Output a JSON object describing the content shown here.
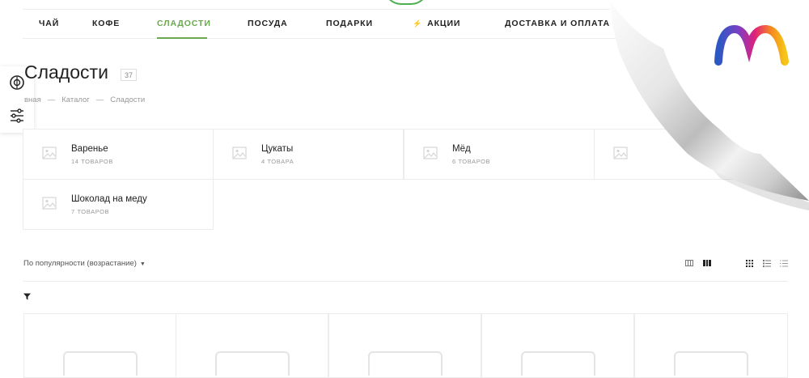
{
  "nav": {
    "items": [
      "ЧАЙ",
      "КОФЕ",
      "СЛАДОСТИ",
      "ПОСУДА",
      "ПОДАРКИ",
      "АКЦИИ",
      "ДОСТАВКА И ОПЛАТА"
    ],
    "active": "СЛАДОСТИ"
  },
  "page": {
    "title": "Сладости",
    "count": "37"
  },
  "breadcrumbs": [
    "вная",
    "Каталог",
    "Сладости"
  ],
  "categories": [
    {
      "name": "Варенье",
      "count": "14 ТОВАРОВ"
    },
    {
      "name": "Цукаты",
      "count": "4 ТОВАРА"
    },
    {
      "name": "Мёд",
      "count": "6 ТОВАРОВ"
    },
    {
      "name": "Шоколад на меду",
      "count": "7 ТОВАРОВ"
    }
  ],
  "sort": {
    "label": "По популярности (возрастание)"
  },
  "icons": {
    "side_panel": [
      "currency-icon",
      "filter-sliders-icon"
    ],
    "view": [
      "grid-compact-icon",
      "grid-wide-icon",
      "tiles-icon",
      "list-icon",
      "list-compact-icon"
    ],
    "filter": "filter-funnel-icon",
    "placeholder": "image-placeholder-icon"
  },
  "colors": {
    "accent": "#6aa84f",
    "text": "#222222",
    "muted": "#999999",
    "border": "#ececec"
  }
}
